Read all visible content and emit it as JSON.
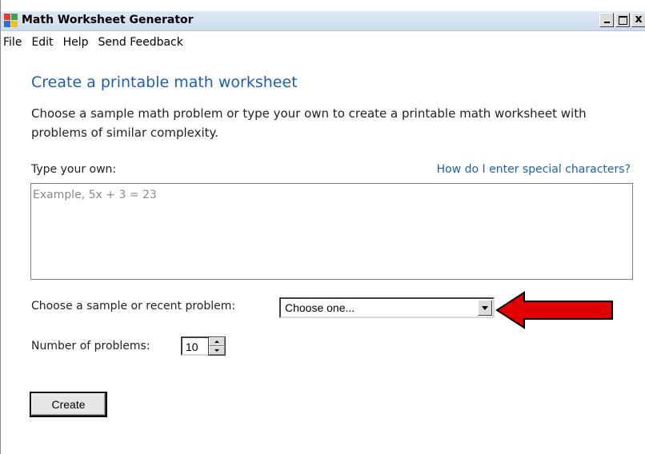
{
  "window": {
    "title": "Math Worksheet Generator",
    "controls": {
      "minimize": "_",
      "maximize": "□",
      "close": "x"
    }
  },
  "menu": {
    "items": [
      "File",
      "Edit",
      "Help",
      "Send Feedback"
    ]
  },
  "main": {
    "heading": "Create a printable math worksheet",
    "description": "Choose a sample math problem or type your own to create a printable math worksheet with problems of similar complexity.",
    "type_label": "Type your own:",
    "help_link": "How do I enter special characters?",
    "problem_placeholder": "Example, 5x + 3 = 23",
    "problem_value": "",
    "sample_label": "Choose a sample or recent problem:",
    "sample_selected": "Choose one...",
    "count_label": "Number of problems:",
    "count_value": "10",
    "create_label": "Create"
  },
  "colors": {
    "heading": "#1f5fb3",
    "link": "#1f5fb3",
    "annotation_arrow": "#e00000"
  },
  "icons": {
    "app": "math-worksheet-app-icon",
    "dropdown": "chevron-down-icon",
    "annotation": "red-arrow-icon"
  }
}
